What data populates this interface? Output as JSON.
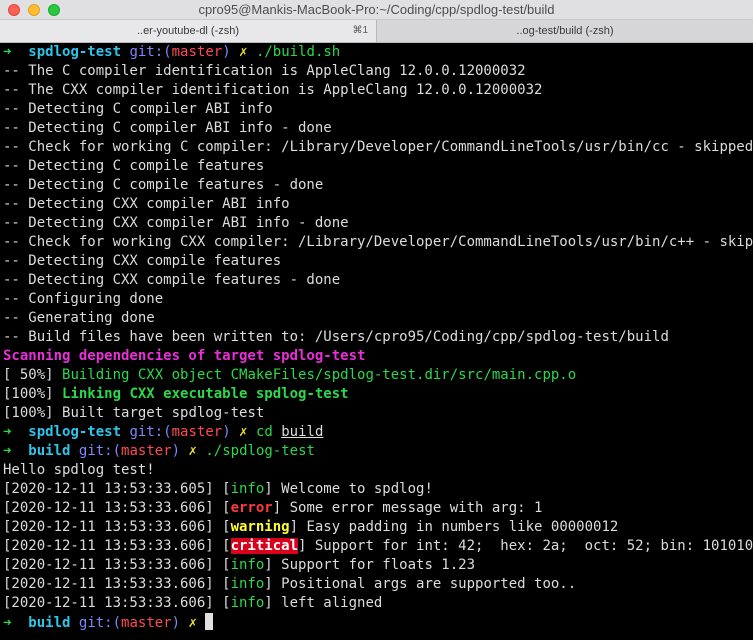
{
  "window": {
    "title": "cpro95@Mankis-MacBook-Pro:~/Coding/cpp/spdlog-test/build",
    "tabs": [
      {
        "label": "..er-youtube-dl (-zsh)",
        "shortcut": "⌘1"
      },
      {
        "label": "..og-test/build (-zsh)",
        "shortcut": ""
      }
    ]
  },
  "colors": {
    "arrow": "#2bd94a",
    "dir": "#2fc4ea",
    "git": "#7f86ff",
    "branch": "#ff4a52",
    "x": "#e9e233",
    "scan": "#e92fd7"
  },
  "prompt1": {
    "arrow": "➜",
    "dir": "spdlog-test",
    "git": "git:(",
    "branch": "master",
    "gitclose": ")",
    "x": "✗",
    "cmd": "./build.sh"
  },
  "cmake": [
    "-- The C compiler identification is AppleClang 12.0.0.12000032",
    "-- The CXX compiler identification is AppleClang 12.0.0.12000032",
    "-- Detecting C compiler ABI info",
    "-- Detecting C compiler ABI info - done",
    "-- Check for working C compiler: /Library/Developer/CommandLineTools/usr/bin/cc - skipped",
    "-- Detecting C compile features",
    "-- Detecting C compile features - done",
    "-- Detecting CXX compiler ABI info",
    "-- Detecting CXX compiler ABI info - done",
    "-- Check for working CXX compiler: /Library/Developer/CommandLineTools/usr/bin/c++ - skipped",
    "-- Detecting CXX compile features",
    "-- Detecting CXX compile features - done",
    "-- Configuring done",
    "-- Generating done",
    "-- Build files have been written to: /Users/cpro95/Coding/cpp/spdlog-test/build"
  ],
  "scan": "Scanning dependencies of target spdlog-test",
  "build": [
    {
      "pct": "[ 50%]",
      "text": "Building CXX object CMakeFiles/spdlog-test.dir/src/main.cpp.o",
      "style": "g"
    },
    {
      "pct": "[100%]",
      "text": "Linking CXX executable spdlog-test",
      "style": "gb"
    },
    {
      "pct": "[100%]",
      "text": "Built target spdlog-test",
      "style": ""
    }
  ],
  "prompt2": {
    "arrow": "➜",
    "dir": "spdlog-test",
    "git": "git:(",
    "branch": "master",
    "gitclose": ")",
    "x": "✗",
    "cmd_pre": "cd",
    "cmd_arg": "build"
  },
  "prompt3": {
    "arrow": "➜",
    "dir": "build",
    "git": "git:(",
    "branch": "master",
    "gitclose": ")",
    "x": "✗",
    "cmd": "./spdlog-test"
  },
  "hello": "Hello spdlog test!",
  "logs": [
    {
      "ts": "[2020-12-11 13:53:33.605]",
      "level": "info",
      "msg": "Welcome to spdlog!"
    },
    {
      "ts": "[2020-12-11 13:53:33.606]",
      "level": "error",
      "msg": "Some error message with arg: 1"
    },
    {
      "ts": "[2020-12-11 13:53:33.606]",
      "level": "warning",
      "msg": "Easy padding in numbers like 00000012"
    },
    {
      "ts": "[2020-12-11 13:53:33.606]",
      "level": "critical",
      "msg": "Support for int: 42;  hex: 2a;  oct: 52; bin: 101010"
    },
    {
      "ts": "[2020-12-11 13:53:33.606]",
      "level": "info",
      "msg": "Support for floats 1.23"
    },
    {
      "ts": "[2020-12-11 13:53:33.606]",
      "level": "info",
      "msg": "Positional args are supported too.."
    },
    {
      "ts": "[2020-12-11 13:53:33.606]",
      "level": "info",
      "msg": "left aligned"
    }
  ],
  "prompt4": {
    "arrow": "➜",
    "dir": "build",
    "git": "git:(",
    "branch": "master",
    "gitclose": ")",
    "x": "✗"
  }
}
